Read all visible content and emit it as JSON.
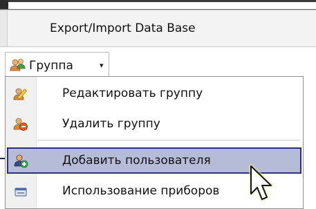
{
  "menu": {
    "export_import_label": "Export/Import Data Base"
  },
  "toolbar": {
    "group_label": "Группа",
    "group_icon": "users-group-icon",
    "dropdown_arrow": "▾"
  },
  "dropdown": {
    "items": [
      {
        "label": "Редактировать группу",
        "icon": "edit-group-icon"
      },
      {
        "label": "Удалить группу",
        "icon": "delete-group-icon"
      },
      {
        "label": "Добавить пользователя",
        "icon": "add-user-icon",
        "highlighted": true
      },
      {
        "label": "Использование приборов",
        "icon": "device-usage-icon"
      }
    ]
  },
  "colors": {
    "highlight_bg": "#b6bbd8",
    "highlight_border": "#2b2f78"
  }
}
